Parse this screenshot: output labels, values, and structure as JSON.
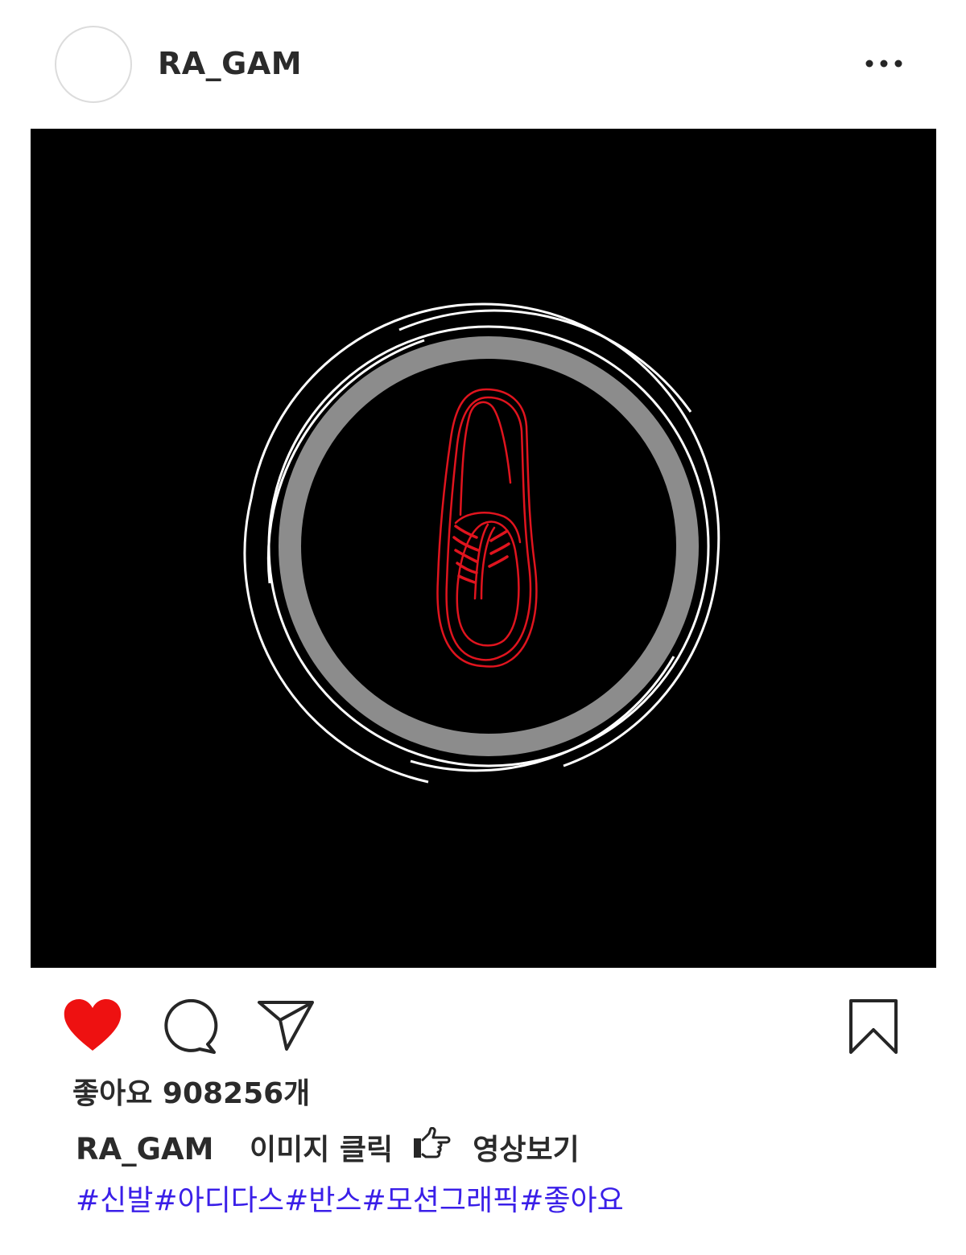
{
  "header": {
    "username": "RA_GAM",
    "more_icon": "ellipsis-icon"
  },
  "post": {
    "media_description_icon": "shoe-icon",
    "colors": {
      "background": "#000000",
      "ring_gray": "#8c8c8c",
      "ring_white": "#ffffff",
      "shoe_red": "#e0141e"
    }
  },
  "actions": {
    "like_icon": "heart-icon",
    "like_color": "#ee1111",
    "comment_icon": "comment-bubble-icon",
    "share_icon": "paper-plane-icon",
    "save_icon": "bookmark-icon"
  },
  "likes": {
    "text": "좋아요 908256개"
  },
  "caption": {
    "username": "RA_GAM",
    "text_before": "이미지 클릭",
    "icon": "pointing-hand-icon",
    "text_after": "영상보기"
  },
  "hashtags": [
    "#신발",
    "#아디다스",
    "#반스",
    "#모션그래픽",
    "#좋아요"
  ],
  "hashtag_color": "#3a1fe8"
}
